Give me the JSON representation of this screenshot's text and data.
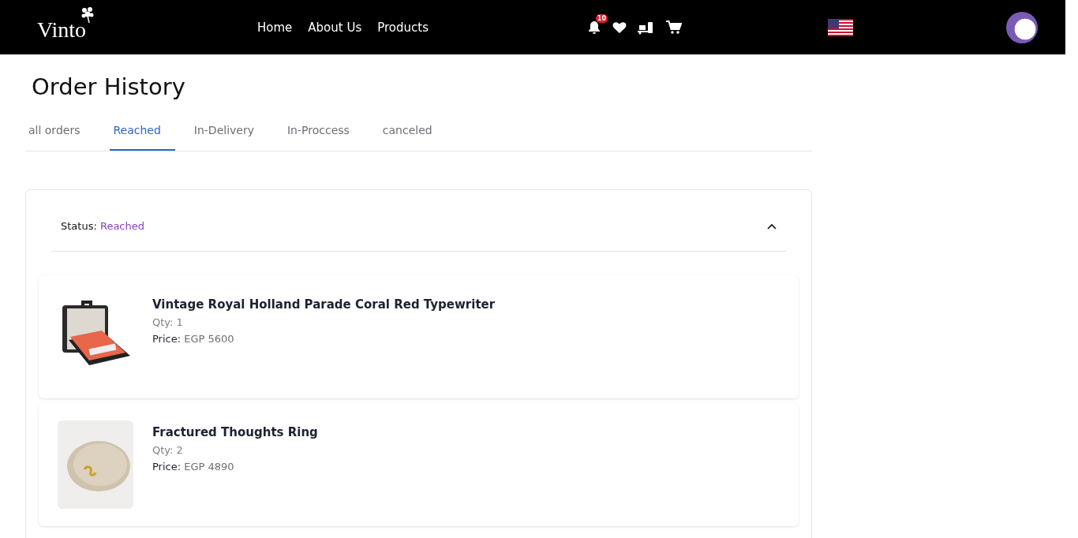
{
  "navbar": {
    "logo": "Vinto",
    "links": [
      "Home",
      "About Us",
      "Products"
    ],
    "notification_count": "10"
  },
  "page_title": "Order History",
  "tabs": [
    {
      "label": "all orders",
      "selected": false
    },
    {
      "label": "Reached",
      "selected": true
    },
    {
      "label": "In-Delivery",
      "selected": false
    },
    {
      "label": "In-Proccess",
      "selected": false
    },
    {
      "label": "canceled",
      "selected": false
    }
  ],
  "order": {
    "status_label": "Status:",
    "status": "Reached",
    "expanded": true,
    "items": [
      {
        "name": "Vintage Royal Holland Parade Coral Red Typewriter",
        "qty": "Qty: 1",
        "price_label": "Price:",
        "price": "EGP 5600",
        "kind": "typewriter"
      },
      {
        "name": "Fractured Thoughts Ring",
        "qty": "Qty: 2",
        "price_label": "Price:",
        "price": "EGP 4890",
        "kind": "ring"
      }
    ]
  }
}
